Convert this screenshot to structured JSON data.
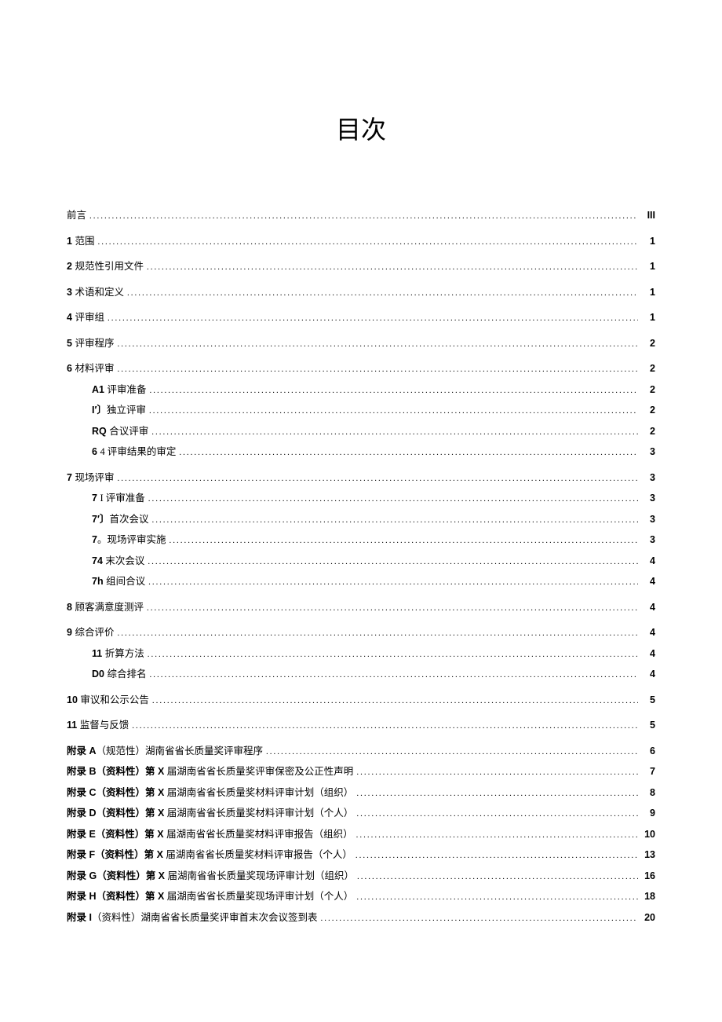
{
  "title": "目次",
  "entries": [
    {
      "label": "前言",
      "page": "III",
      "indent": false,
      "bold_prefix": ""
    },
    {
      "label": "范围",
      "page": "1",
      "indent": false,
      "bold_prefix": "1 "
    },
    {
      "label": "规范性引用文件",
      "page": "1",
      "indent": false,
      "bold_prefix": "2 "
    },
    {
      "label": "术语和定义",
      "page": "1",
      "indent": false,
      "bold_prefix": "3 "
    },
    {
      "label": "评审组",
      "page": "1",
      "indent": false,
      "bold_prefix": "4 "
    },
    {
      "label": "评审程序",
      "page": "2",
      "indent": false,
      "bold_prefix": "5 "
    },
    {
      "label": "材料评审",
      "page": "2",
      "indent": false,
      "bold_prefix": "6 "
    },
    {
      "label": "评审准备",
      "page": "2",
      "indent": true,
      "bold_prefix": "A1 "
    },
    {
      "label": "独立评审",
      "page": "2",
      "indent": true,
      "bold_prefix": "I′〕"
    },
    {
      "label": "合议评审",
      "page": "2",
      "indent": true,
      "bold_prefix": "RQ "
    },
    {
      "label": "4 评审结果的审定",
      "page": "3",
      "indent": true,
      "bold_prefix": "6 "
    },
    {
      "label": "现场评审",
      "page": "3",
      "indent": false,
      "bold_prefix": "7 "
    },
    {
      "label": "I 评审准备",
      "page": "3",
      "indent": true,
      "bold_prefix": "7 "
    },
    {
      "label": "首次会议",
      "page": "3",
      "indent": true,
      "bold_prefix": "7′〕"
    },
    {
      "label": "。现场评审实施",
      "page": "3",
      "indent": true,
      "bold_prefix": "7"
    },
    {
      "label": "末次会议",
      "page": "4",
      "indent": true,
      "bold_prefix": "74 "
    },
    {
      "label": "组间合议",
      "page": "4",
      "indent": true,
      "bold_prefix": "7h "
    },
    {
      "label": "顾客满意度测评",
      "page": "4",
      "indent": false,
      "bold_prefix": "8 "
    },
    {
      "label": "综合评价",
      "page": "4",
      "indent": false,
      "bold_prefix": "9 "
    },
    {
      "label": "折算方法",
      "page": "4",
      "indent": true,
      "bold_prefix": "11 "
    },
    {
      "label": "综合排名",
      "page": "4",
      "indent": true,
      "bold_prefix": "D0 "
    },
    {
      "label": "审议和公示公告",
      "page": "5",
      "indent": false,
      "bold_prefix": "10 "
    },
    {
      "label": "监督与反馈",
      "page": "5",
      "indent": false,
      "bold_prefix": "11 "
    },
    {
      "label": "（规范性）湖南省省长质量奖评审程序",
      "page": "6",
      "indent": false,
      "bold_prefix": "附录 A"
    },
    {
      "label": "届湖南省省长质量奖评审保密及公正性声明",
      "page": "7",
      "indent": false,
      "bold_prefix": "附录 B（资料性）第 X "
    },
    {
      "label": "届湖南省省长质量奖材料评审计划（组织）",
      "page": "8",
      "indent": false,
      "bold_prefix": "附录 C（资料性）第 X "
    },
    {
      "label": "届湖南省省长质量奖材料评审计划（个人）",
      "page": "9",
      "indent": false,
      "bold_prefix": "附录 D（资料性）第 X "
    },
    {
      "label": "届湖南省省长质量奖材料评审报告（组织）",
      "page": "10",
      "indent": false,
      "bold_prefix": "附录 E（资料性）第 X "
    },
    {
      "label": "届湖南省省长质量奖材料评审报告（个人）",
      "page": "13",
      "indent": false,
      "bold_prefix": "附录 F（资料性）第 X "
    },
    {
      "label": "届湖南省省长质量奖现场评审计划（组织）",
      "page": "16",
      "indent": false,
      "bold_prefix": "附录 G（资料性）第 X "
    },
    {
      "label": "届湖南省省长质量奖现场评审计划（个人）",
      "page": "18",
      "indent": false,
      "bold_prefix": "附录 H（资料性）第 X "
    },
    {
      "label": "（资料性）湖南省省长质量奖评审首末次会议签到表",
      "page": "20",
      "indent": false,
      "bold_prefix": "附录 I"
    }
  ],
  "spacers_after": [
    0,
    1,
    2,
    3,
    4,
    5,
    10,
    16,
    17,
    20,
    21,
    22
  ]
}
